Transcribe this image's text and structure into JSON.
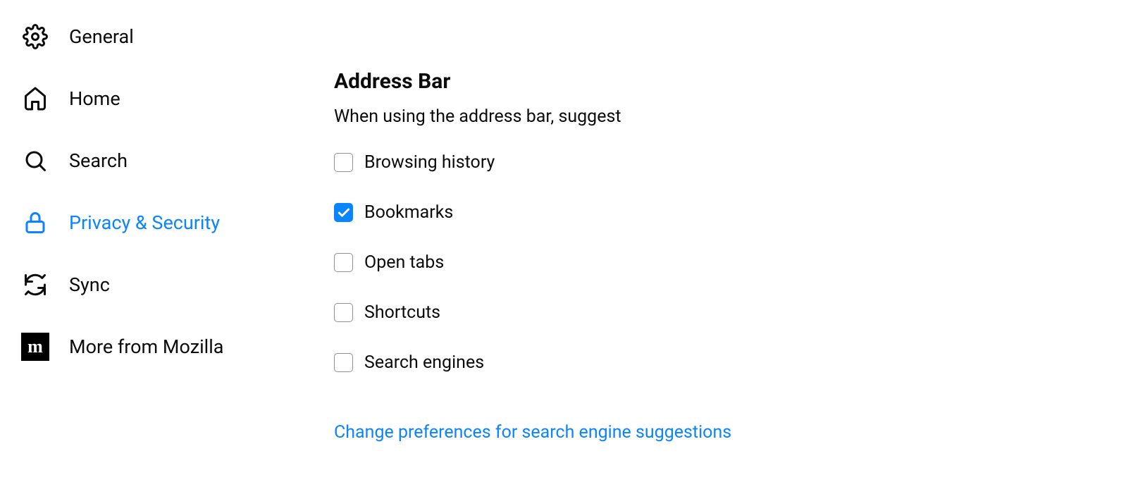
{
  "sidebar": {
    "items": [
      {
        "key": "general",
        "label": "General"
      },
      {
        "key": "home",
        "label": "Home"
      },
      {
        "key": "search",
        "label": "Search"
      },
      {
        "key": "privacy",
        "label": "Privacy & Security"
      },
      {
        "key": "sync",
        "label": "Sync"
      },
      {
        "key": "more",
        "label": "More from Mozilla"
      }
    ],
    "active_key": "privacy"
  },
  "main": {
    "section_title": "Address Bar",
    "section_sub": "When using the address bar, suggest",
    "options": [
      {
        "key": "history",
        "label": "Browsing history",
        "checked": false
      },
      {
        "key": "bookmarks",
        "label": "Bookmarks",
        "checked": true
      },
      {
        "key": "opentabs",
        "label": "Open tabs",
        "checked": false
      },
      {
        "key": "shortcuts",
        "label": "Shortcuts",
        "checked": false
      },
      {
        "key": "engines",
        "label": "Search engines",
        "checked": false
      }
    ],
    "link": "Change preferences for search engine suggestions"
  },
  "colors": {
    "accent": "#0a84ff"
  }
}
